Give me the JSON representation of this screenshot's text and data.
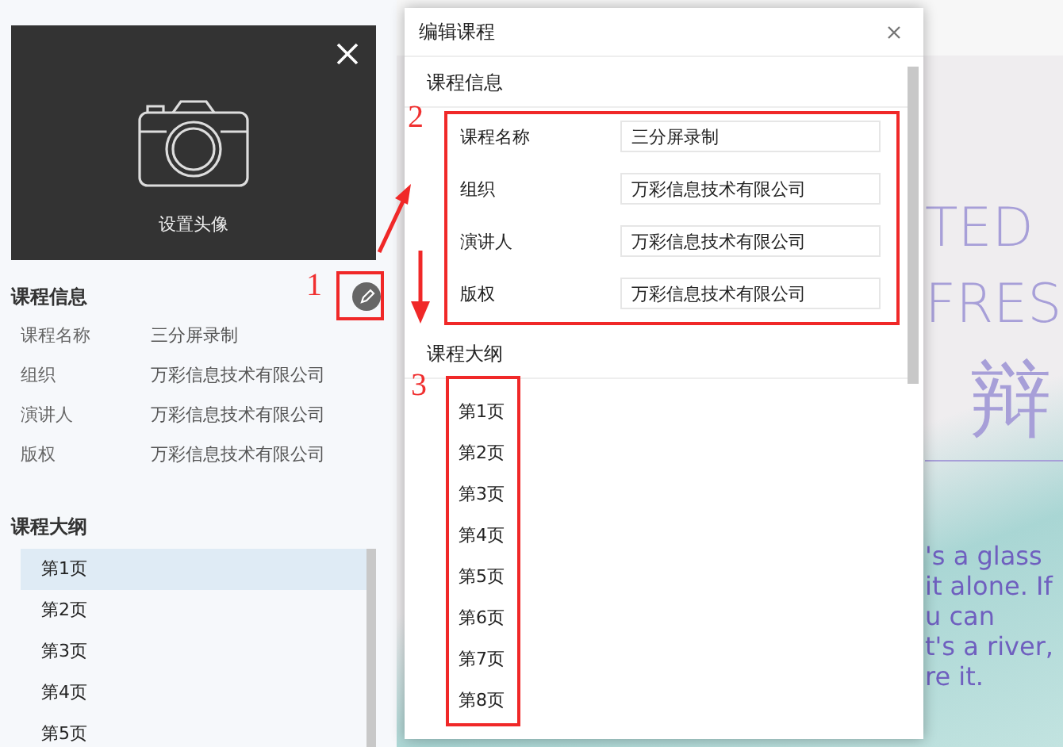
{
  "sidebar": {
    "cover": {
      "caption": "设置头像"
    },
    "info": {
      "title": "课程信息",
      "rows": [
        {
          "label": "课程名称",
          "value": "三分屏录制"
        },
        {
          "label": "组织",
          "value": "万彩信息技术有限公司"
        },
        {
          "label": "演讲人",
          "value": "万彩信息技术有限公司"
        },
        {
          "label": "版权",
          "value": "万彩信息技术有限公司"
        }
      ]
    },
    "outline": {
      "title": "课程大纲",
      "items": [
        {
          "label": "第1页",
          "selected": true
        },
        {
          "label": "第2页",
          "selected": false
        },
        {
          "label": "第3页",
          "selected": false
        },
        {
          "label": "第4页",
          "selected": false
        },
        {
          "label": "第5页",
          "selected": false
        }
      ]
    }
  },
  "dialog": {
    "title": "编辑课程",
    "info": {
      "title": "课程信息",
      "fields": [
        {
          "label": "课程名称",
          "value": "三分屏录制"
        },
        {
          "label": "组织",
          "value": "万彩信息技术有限公司"
        },
        {
          "label": "演讲人",
          "value": "万彩信息技术有限公司"
        },
        {
          "label": "版权",
          "value": "万彩信息技术有限公司"
        }
      ]
    },
    "outline": {
      "title": "课程大纲",
      "items": [
        "第1页",
        "第2页",
        "第3页",
        "第4页",
        "第5页",
        "第6页",
        "第7页",
        "第8页"
      ]
    }
  },
  "slide": {
    "heading_lines": [
      "TED",
      "FRES"
    ],
    "chinese_title": "辩",
    "text_lines": [
      "'s a glass",
      "it alone. If",
      "u can",
      "t's a river,",
      "re it."
    ]
  },
  "annotations": [
    "1",
    "2",
    "3"
  ]
}
